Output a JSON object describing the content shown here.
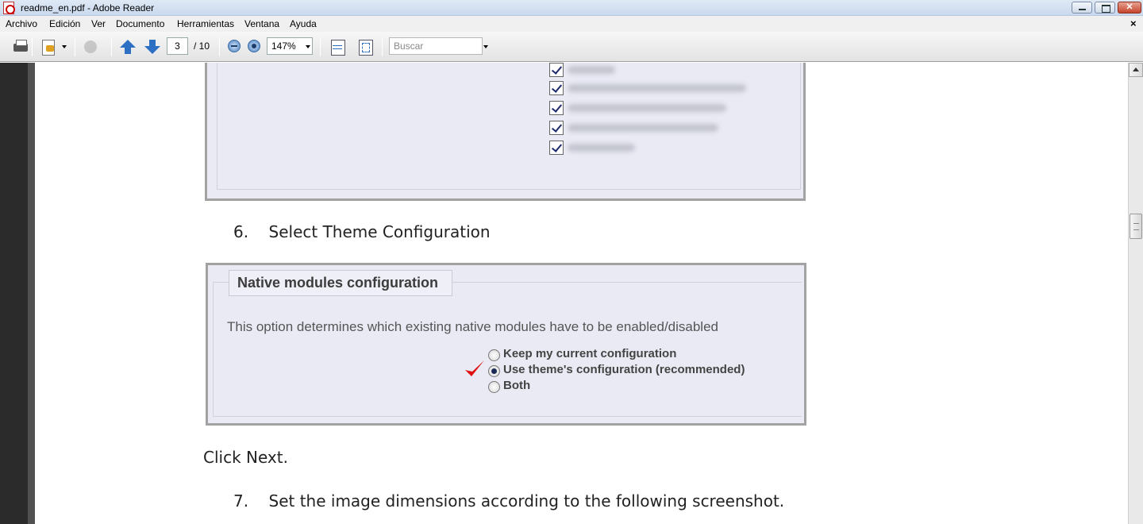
{
  "window": {
    "title": "readme_en.pdf - Adobe Reader",
    "close_glyph": "✕"
  },
  "menu": {
    "items": [
      "Archivo",
      "Edición",
      "Ver",
      "Documento",
      "Herramientas",
      "Ventana",
      "Ayuda"
    ],
    "close_glyph": "×"
  },
  "toolbar": {
    "current_page": "3",
    "total_pages": "/ 10",
    "zoom": "147%",
    "search_placeholder": "Buscar"
  },
  "document": {
    "step6": "6.    Select Theme Configuration",
    "click_next": "Click Next.",
    "step7": "7.    Set the image dimensions according to the following screenshot.",
    "native_box": {
      "legend": "Native modules configuration",
      "description": "This option determines which existing native modules have to be enabled/disabled",
      "options": [
        {
          "label": "Keep my current configuration",
          "selected": false
        },
        {
          "label": "Use theme's configuration (recommended)",
          "selected": true
        },
        {
          "label": "Both",
          "selected": false
        }
      ]
    }
  },
  "colors": {
    "accent_blue": "#2d6fc2",
    "checkmark_red": "#e01010",
    "embed_background": "#e9eaf4"
  }
}
